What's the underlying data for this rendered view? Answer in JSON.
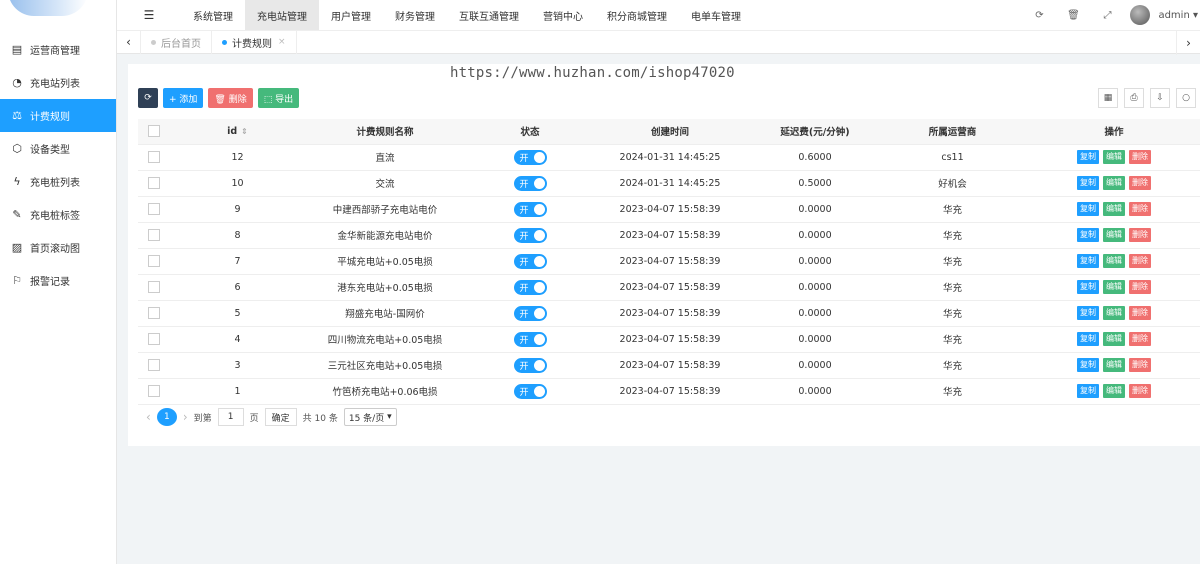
{
  "sidebar": {
    "items": [
      {
        "label": "运营商管理",
        "icon": "building-icon"
      },
      {
        "label": "充电站列表",
        "icon": "pie-icon"
      },
      {
        "label": "计费规则",
        "icon": "scale-icon",
        "active": true
      },
      {
        "label": "设备类型",
        "icon": "stamp-icon"
      },
      {
        "label": "充电桩列表",
        "icon": "bolt-icon"
      },
      {
        "label": "充电桩标签",
        "icon": "tag-icon"
      },
      {
        "label": "首页滚动图",
        "icon": "image-icon"
      },
      {
        "label": "报警记录",
        "icon": "alarm-icon"
      }
    ]
  },
  "topnav": {
    "items": [
      "系统管理",
      "充电站管理",
      "用户管理",
      "财务管理",
      "互联互通管理",
      "营销中心",
      "积分商城管理",
      "电单车管理"
    ],
    "active_index": 1,
    "user": "admin"
  },
  "tabs": {
    "home": "后台首页",
    "current": "计费规则",
    "close": "×"
  },
  "watermark": "https://www.huzhan.com/ishop47020",
  "toolbar": {
    "refresh": "⟳",
    "add": "+ 添加",
    "delete": "🗑 删除",
    "export": "⬚ 导出"
  },
  "table": {
    "headers": [
      "id",
      "计费规则名称",
      "状态",
      "创建时间",
      "延迟费(元/分钟)",
      "所属运营商",
      "操作"
    ],
    "switch_label": "开",
    "op_labels": {
      "copy": "复制",
      "edit": "编辑",
      "del": "删除"
    },
    "rows": [
      {
        "id": "12",
        "name": "直流",
        "created": "2024-01-31 14:45:25",
        "fee": "0.6000",
        "operator": "cs11"
      },
      {
        "id": "10",
        "name": "交流",
        "created": "2024-01-31 14:45:25",
        "fee": "0.5000",
        "operator": "好机会"
      },
      {
        "id": "9",
        "name": "中建西部骄子充电站电价",
        "created": "2023-04-07 15:58:39",
        "fee": "0.0000",
        "operator": "华充"
      },
      {
        "id": "8",
        "name": "金华新能源充电站电价",
        "created": "2023-04-07 15:58:39",
        "fee": "0.0000",
        "operator": "华充"
      },
      {
        "id": "7",
        "name": "平城充电站+0.05电损",
        "created": "2023-04-07 15:58:39",
        "fee": "0.0000",
        "operator": "华充"
      },
      {
        "id": "6",
        "name": "港东充电站+0.05电损",
        "created": "2023-04-07 15:58:39",
        "fee": "0.0000",
        "operator": "华充"
      },
      {
        "id": "5",
        "name": "翔盛充电站-国网价",
        "created": "2023-04-07 15:58:39",
        "fee": "0.0000",
        "operator": "华充"
      },
      {
        "id": "4",
        "name": "四川物流充电站+0.05电损",
        "created": "2023-04-07 15:58:39",
        "fee": "0.0000",
        "operator": "华充"
      },
      {
        "id": "3",
        "name": "三元社区充电站+0.05电损",
        "created": "2023-04-07 15:58:39",
        "fee": "0.0000",
        "operator": "华充"
      },
      {
        "id": "1",
        "name": "竹笆桥充电站+0.06电损",
        "created": "2023-04-07 15:58:39",
        "fee": "0.0000",
        "operator": "华充"
      }
    ]
  },
  "pager": {
    "prev": "‹",
    "current": "1",
    "next": "›",
    "goto": "到第",
    "page_input": "1",
    "page_unit": "页",
    "confirm": "确定",
    "total": "共 10 条",
    "per_page": "15 条/页"
  },
  "colors": {
    "primary": "#1e9fff",
    "success": "#45b97c",
    "danger": "#f0706f",
    "dark": "#2f4056"
  }
}
